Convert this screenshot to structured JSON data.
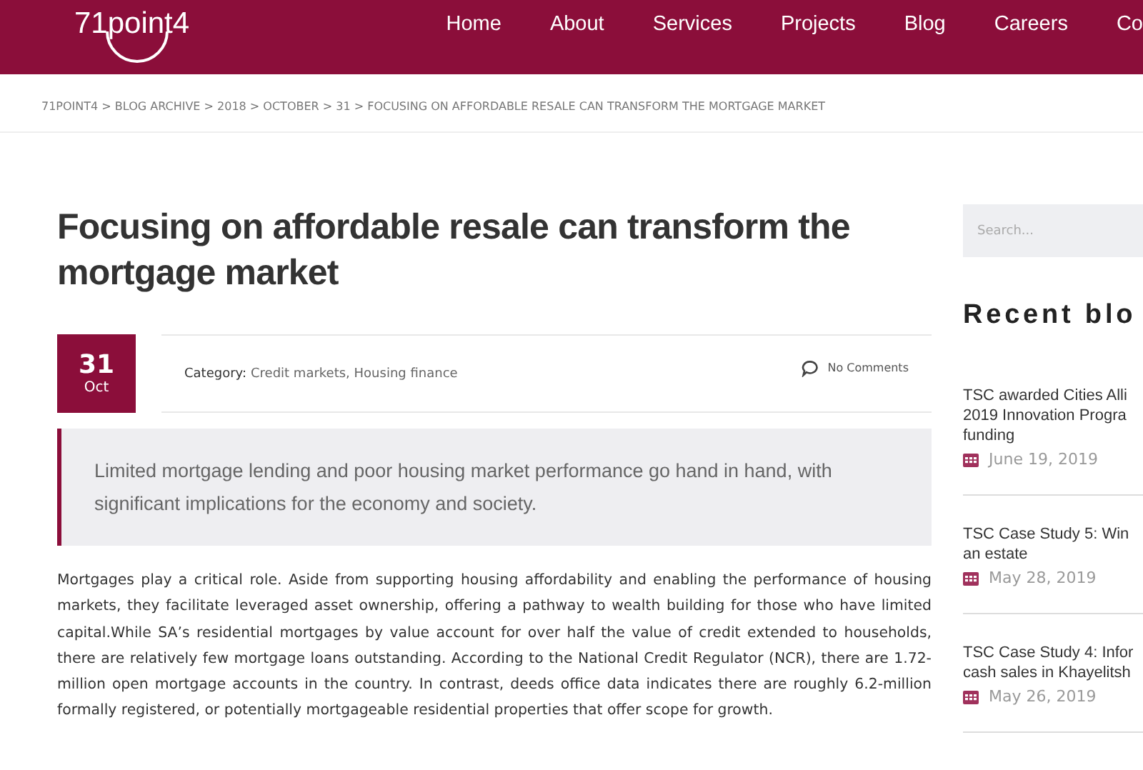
{
  "header": {
    "logo": "71point4",
    "nav": [
      {
        "label": "Home"
      },
      {
        "label": "About"
      },
      {
        "label": "Services"
      },
      {
        "label": "Projects"
      },
      {
        "label": "Blog"
      },
      {
        "label": "Careers"
      },
      {
        "label": "Co"
      }
    ]
  },
  "breadcrumb": "71POINT4 > BLOG ARCHIVE > 2018 > OCTOBER > 31 > FOCUSING ON AFFORDABLE RESALE CAN TRANSFORM THE MORTGAGE MARKET",
  "article": {
    "title": "Focusing on affordable resale can transform the mortgage market",
    "date": {
      "day": "31",
      "month": "Oct"
    },
    "category_label": "Category:",
    "categories": "Credit markets, Housing finance",
    "comments": "No Comments",
    "quote": "Limited mortgage lending and poor housing market performance go hand in hand, with significant implications for the economy and society.",
    "body": "Mortgages play a critical role. Aside from supporting housing affordability and enabling the performance of housing markets, they facilitate leveraged asset ownership, offering a pathway to wealth building for those who have limited capital.While SA’s residential mortgages by value account for over half the value of credit extended to households, there are relatively few mortgage loans outstanding. According to the National Credit Regulator (NCR), there are 1.72-million open mortgage accounts in the country. In contrast, deeds office data indicates there are roughly 6.2-million formally registered, or potentially mortgageable residential properties that offer scope for growth."
  },
  "sidebar": {
    "search": {
      "placeholder": "Search..."
    },
    "heading": "Recent blo",
    "posts": [
      {
        "lines": [
          "TSC awarded Cities Alli",
          "2019 Innovation Progra",
          "funding"
        ],
        "date": "June 19, 2019"
      },
      {
        "lines": [
          "TSC Case Study 5: Win",
          "an estate"
        ],
        "date": "May 28, 2019"
      },
      {
        "lines": [
          "TSC Case Study 4: Infor",
          "cash sales in Khayelitsh"
        ],
        "date": "May 26, 2019"
      }
    ]
  }
}
